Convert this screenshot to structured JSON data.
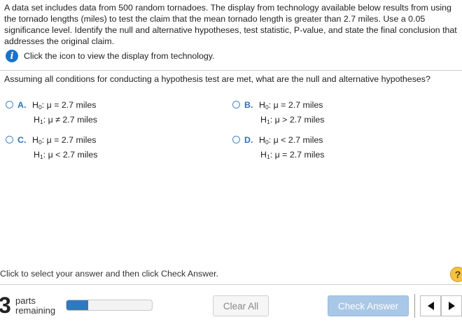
{
  "problem": {
    "text": "A data set includes data from 500 random tornadoes. The display from technology available below results from using the tornado lengths (miles) to test the claim that the mean tornado length is greater than 2.7 miles. Use a 0.05 significance level. Identify the null and alternative hypotheses, test statistic, P-value, and state the final conclusion that addresses the original claim.",
    "tech_link": "Click the icon to view the display from technology."
  },
  "question": "Assuming all conditions for conducting a hypothesis test are met, what are the null and alternative hypotheses?",
  "h0": "H",
  "sub0": "0",
  "sub1": "1",
  "options": [
    {
      "letter": "A.",
      "h0": ": μ = 2.7 miles",
      "h1": ": μ ≠ 2.7 miles"
    },
    {
      "letter": "B.",
      "h0": ": μ = 2.7 miles",
      "h1": ": μ > 2.7 miles"
    },
    {
      "letter": "C.",
      "h0": ": μ = 2.7 miles",
      "h1": ": μ < 2.7 miles"
    },
    {
      "letter": "D.",
      "h0": ": μ < 2.7 miles",
      "h1": ": μ = 2.7 miles"
    }
  ],
  "footer": {
    "hint": "Click to select your answer and then click Check Answer.",
    "help_symbol": "?",
    "parts_count": "3",
    "parts_label_1": "parts",
    "parts_label_2": "remaining",
    "progress_fraction": 0.25,
    "clear_label": "Clear All",
    "check_label": "Check Answer"
  },
  "icons": {
    "info": "info-icon",
    "help": "help-icon",
    "prev": "triangle-left-icon",
    "next": "triangle-right-icon"
  },
  "colors": {
    "accent": "#2f6fb3",
    "info_icon": "#1a73c9",
    "progress_fill": "#2f79c2",
    "check_button": "#a9c7e6",
    "help_icon": "#f5c242"
  }
}
